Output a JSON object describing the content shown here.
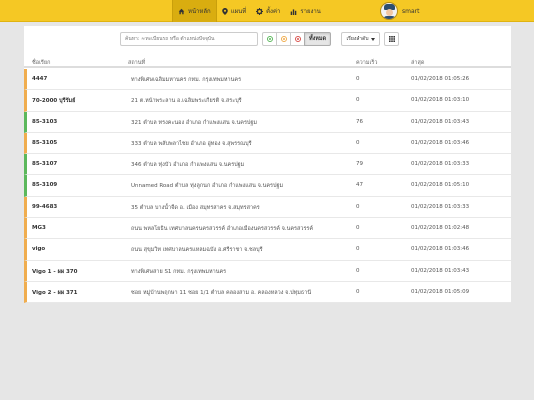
{
  "nav": {
    "items": [
      {
        "label": "หน้าหลัก",
        "icon": "home-icon"
      },
      {
        "label": "แผนที่",
        "icon": "map-marker-icon"
      },
      {
        "label": "ตั้งค่า",
        "icon": "gear-icon"
      },
      {
        "label": "รายงาน",
        "icon": "bar-chart-icon"
      }
    ],
    "active_index": 0,
    "username": "smart"
  },
  "toolbar": {
    "search_placeholder": "ค้นหา: ≈ทะเบียนรถ หรือ ตำแหน่งปัจจุบัน",
    "filters": [
      {
        "name": "running",
        "color": "#5cb85c"
      },
      {
        "name": "idle",
        "color": "#f0ad4e"
      },
      {
        "name": "stopped",
        "color": "#d9534f"
      }
    ],
    "all_label": "ทั้งหมด",
    "sort_label": "เรียงลำดับ"
  },
  "table": {
    "headers": {
      "name": "ชื่อเรียก",
      "location": "สถานที่",
      "speed": "ความเร็ว",
      "time": "ล่าสุด"
    },
    "rows": [
      {
        "name": "4447",
        "location": "ทางพิเศษเฉลิมมหานคร กทม. กรุงเทพมหานคร",
        "speed": "0",
        "time": "01/02/2018 01:05:26",
        "status": "#f0ad4e"
      },
      {
        "name": "70-2000 บุรีรัมย์",
        "location": "21 ต.หน้าพระลาน อ.เฉลิมพระเกียรติ จ.สระบุรี",
        "speed": "0",
        "time": "01/02/2018 01:03:10",
        "status": "#f0ad4e"
      },
      {
        "name": "85-3103",
        "location": "321 ตำบล ทรงคะนอง อำเภอ กำแพงแสน จ.นครปฐม",
        "speed": "76",
        "time": "01/02/2018 01:03:43",
        "status": "#5cb85c"
      },
      {
        "name": "85-3105",
        "location": "333 ตำบล พลับพลาไชย อำเภอ อู่ทอง จ.สุพรรณบุรี",
        "speed": "0",
        "time": "01/02/2018 01:03:46",
        "status": "#f0ad4e"
      },
      {
        "name": "85-3107",
        "location": "346 ตำบล ทุ่งบัว อำเภอ กำแพงแสน จ.นครปฐม",
        "speed": "79",
        "time": "01/02/2018 01:03:33",
        "status": "#5cb85c"
      },
      {
        "name": "85-3109",
        "location": "Unnamed Road ตำบล ทุ่งลูกนก อำเภอ กำแพงแสน จ.นครปฐม",
        "speed": "47",
        "time": "01/02/2018 01:05:10",
        "status": "#5cb85c"
      },
      {
        "name": "99-4683",
        "location": "35 ตำบล บางน้ำจืด อ. เมือง สมุทรสาคร จ.สมุทรสาคร",
        "speed": "0",
        "time": "01/02/2018 01:03:33",
        "status": "#f0ad4e"
      },
      {
        "name": "MG3",
        "location": "ถนน พหลโยธิน เทศบาลนครนครสวรรค์ อำเภอเมืองนครสวรรค์ จ.นครสวรรค์",
        "speed": "0",
        "time": "01/02/2018 01:02:48",
        "status": "#f0ad4e"
      },
      {
        "name": "vigo",
        "location": "ถนน สุขุมวิท เทศบาลนครแหลมฉบัง อ.ศรีราชา จ.ชลบุรี",
        "speed": "0",
        "time": "01/02/2018 01:03:46",
        "status": "#f0ad4e"
      },
      {
        "name": "Vigo 1 - ผผ 370",
        "location": "ทางพิเศษสาย S1 กทม. กรุงเทพมหานคร",
        "speed": "0",
        "time": "01/02/2018 01:03:43",
        "status": "#f0ad4e"
      },
      {
        "name": "Vigo 2 - ผผ 371",
        "location": "ซอย หมู่บ้านพฤกษา 11 ซอย 1/1 ตำบล คลองสาม อ. คลองหลวง จ.ปทุมธานี",
        "speed": "0",
        "time": "01/02/2018 01:05:09",
        "status": "#f0ad4e"
      }
    ]
  }
}
